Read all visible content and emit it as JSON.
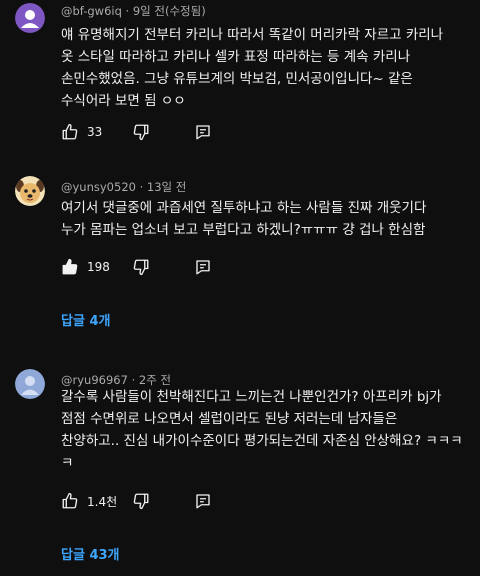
{
  "comments": [
    {
      "author": "@bf-gw6iq",
      "time": "9일 전(수정됨)",
      "lines": [
        "얘 유명해지기 전부터 카리나 따라서 똑같이 머리카락 자르고 카리나",
        "옷 스타일 따라하고 카리나 셀카 표정 따라하는 등 계속 카리나",
        "손민수했었음. 그냥 유튜브계의 박보검, 민서공이입니다~ 같은",
        "수식어라 보면 됨 ㅇㅇ"
      ],
      "likes": "33",
      "avatar_color": "#7e57c2"
    },
    {
      "author": "@yunsy0520",
      "time": "13일 전",
      "lines": [
        "여기서 댓글중에 과즙세연 질투하냐고 하는 사람들 진짜 개웃기다",
        "누가 몸파는 업소녀 보고 부럽다고 하겠니?ㅠㅠㅠ 걍 겁나 한심함"
      ],
      "likes": "198",
      "replies": "답글 4개"
    },
    {
      "author": "@ryu96967",
      "time": "2주 전",
      "lines": [
        "갈수록 사람들이 천박해진다고 느끼는건 나뿐인건가? 아프리카 bj가",
        "점점  수면위로 나오면서 셀럽이라도 된냥 저러는데 남자들은",
        "찬양하고.. 진심 내가이수준이다 평가되는건데 자존심 안상해요? ㅋㅋㅋ",
        "ㅋ"
      ],
      "likes": "1.4천",
      "replies": "답글 43개",
      "avatar_color": "#8fa8d8"
    }
  ],
  "icons": {
    "like": "thumbs-up-icon",
    "dislike": "thumbs-down-icon",
    "reply": "reply-icon"
  }
}
